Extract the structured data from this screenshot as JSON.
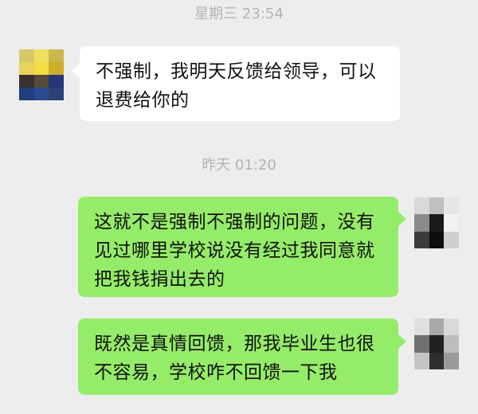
{
  "chat": {
    "timestamp_1": "星期三 23:54",
    "timestamp_2": "昨天 01:20",
    "messages": [
      {
        "sender": "other",
        "text": "不强制，我明天反馈给领导，可以退费给你的"
      },
      {
        "sender": "self",
        "text": "这就不是强制不强制的问题，没有见过哪里学校说没有经过我同意就把我钱捐出去的"
      },
      {
        "sender": "self",
        "text": "既然是真情回馈，那我毕业生也很不容易，学校咋不回馈一下我"
      }
    ]
  },
  "colors": {
    "background": "#ededed",
    "incoming_bubble": "#ffffff",
    "outgoing_bubble": "#95ec69",
    "timestamp_text": "#b3b3b3"
  },
  "icons": {
    "contact_avatar": "pixelated-avatar",
    "self_avatar": "pixelated-avatar"
  }
}
